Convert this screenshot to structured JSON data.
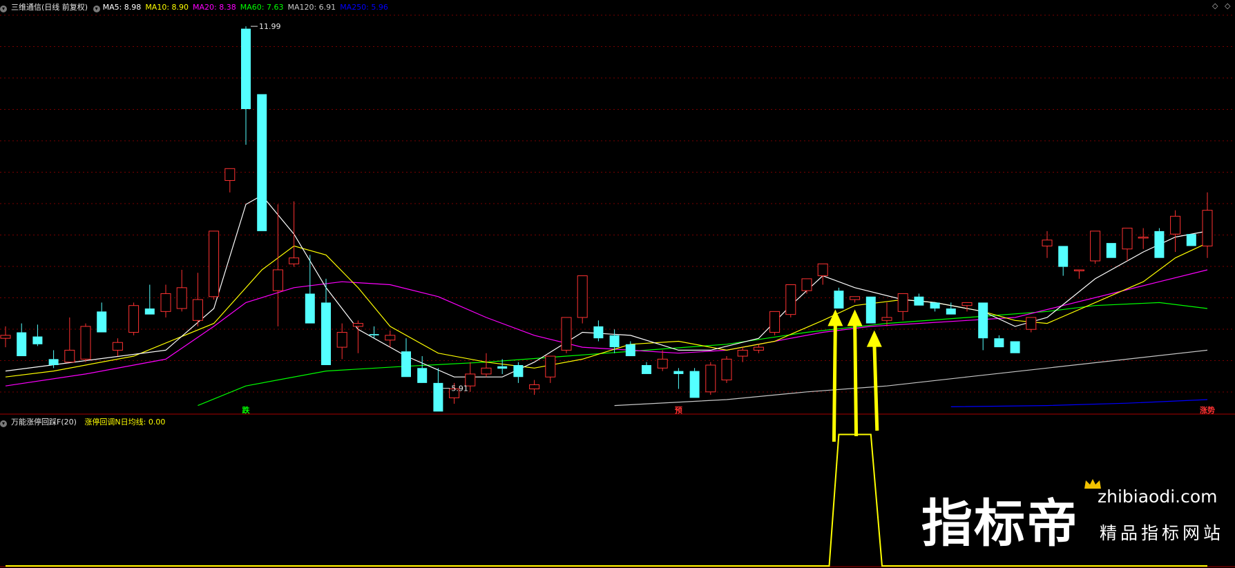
{
  "header_main": {
    "title": "三维通信(日线 前复权)",
    "indicators": [
      {
        "text": "MA5: 8.98",
        "color": "#ffffff"
      },
      {
        "text": "MA10: 8.90",
        "color": "#ffff00"
      },
      {
        "text": "MA20: 8.38",
        "color": "#ff00ff"
      },
      {
        "text": "MA60: 7.63",
        "color": "#00ff00"
      },
      {
        "text": "MA120: 6.91",
        "color": "#c8c8c8"
      },
      {
        "text": "MA250: 5.96",
        "color": "#0000ff"
      }
    ]
  },
  "header_sub": {
    "title": "万能涨停回踩F(20)",
    "indicator": "涨停回调N日均线: 0.00"
  },
  "window_buttons": {
    "restore": "◇",
    "maximize": "◇"
  },
  "watermark": {
    "cn": "指标帝",
    "url": "zhibiaodi.com",
    "sub": "精品指标网站"
  },
  "colors": {
    "up": "#ff3232",
    "down": "#54ffff",
    "ma5": "#ffffff",
    "ma10": "#ffff00",
    "ma20": "#ff00ff",
    "ma60": "#00ff00",
    "ma120": "#c8c8c8",
    "ma250": "#0000ff",
    "grid": "#7a0000",
    "signal": "#ffff00"
  },
  "chart_data": [
    {
      "type": "candlestick",
      "ylim": [
        5.5,
        12.2
      ],
      "annotations": [
        {
          "text": "11.99",
          "candle": 15,
          "price": 11.99
        },
        {
          "text": "5.91",
          "candle": 27,
          "price": 5.91
        }
      ],
      "markers": [
        {
          "text": "跌",
          "candle": 15,
          "color": "#00ff00"
        },
        {
          "text": "预",
          "candle": 42,
          "color": "#ff3232"
        },
        {
          "text": "涨势",
          "candle": 75,
          "color": "#ff3232"
        }
      ],
      "candles": [
        [
          6.75,
          6.95,
          6.6,
          6.8
        ],
        [
          6.85,
          7.0,
          6.45,
          6.45
        ],
        [
          6.78,
          6.98,
          6.62,
          6.65
        ],
        [
          6.4,
          6.55,
          6.25,
          6.3
        ],
        [
          6.35,
          7.1,
          6.35,
          6.55
        ],
        [
          6.4,
          7.0,
          6.35,
          6.95
        ],
        [
          7.2,
          7.35,
          6.9,
          6.85
        ],
        [
          6.55,
          6.75,
          6.45,
          6.68
        ],
        [
          6.85,
          7.35,
          6.8,
          7.3
        ],
        [
          7.25,
          7.65,
          7.2,
          7.15
        ],
        [
          7.2,
          7.65,
          7.1,
          7.5
        ],
        [
          7.25,
          7.9,
          7.2,
          7.6
        ],
        [
          7.05,
          7.85,
          6.95,
          7.4
        ],
        [
          7.45,
          7.95,
          7.4,
          8.55
        ],
        [
          9.4,
          9.6,
          9.2,
          9.6
        ],
        [
          11.95,
          11.99,
          10.0,
          10.6
        ],
        [
          10.85,
          10.85,
          8.55,
          8.55
        ],
        [
          7.55,
          9.0,
          6.95,
          7.9
        ],
        [
          8.0,
          9.05,
          7.95,
          8.1
        ],
        [
          7.5,
          8.15,
          7.15,
          7.0
        ],
        [
          7.35,
          7.75,
          6.85,
          6.3
        ],
        [
          6.6,
          7.0,
          6.4,
          6.85
        ],
        [
          6.95,
          7.05,
          6.5,
          7.0
        ],
        [
          6.82,
          6.95,
          6.75,
          6.8
        ],
        [
          6.72,
          6.88,
          6.6,
          6.8
        ],
        [
          6.53,
          6.75,
          6.3,
          6.1
        ],
        [
          6.25,
          6.45,
          6.0,
          6.0
        ],
        [
          6.0,
          6.25,
          5.65,
          5.52
        ],
        [
          5.75,
          6.0,
          5.65,
          5.9
        ],
        [
          5.95,
          6.35,
          5.85,
          6.15
        ],
        [
          6.15,
          6.5,
          6.1,
          6.25
        ],
        [
          6.28,
          6.4,
          6.15,
          6.24
        ],
        [
          6.3,
          6.35,
          6.0,
          6.1
        ],
        [
          5.9,
          6.05,
          5.8,
          5.97
        ],
        [
          6.1,
          6.25,
          6.0,
          6.45
        ],
        [
          6.55,
          7.0,
          6.5,
          7.1
        ],
        [
          7.1,
          7.3,
          7.0,
          7.8
        ],
        [
          6.95,
          7.05,
          6.7,
          6.75
        ],
        [
          6.8,
          6.9,
          6.5,
          6.6
        ],
        [
          6.65,
          6.7,
          6.45,
          6.45
        ],
        [
          6.3,
          6.35,
          6.15,
          6.15
        ],
        [
          6.25,
          6.55,
          6.2,
          6.4
        ],
        [
          6.2,
          6.25,
          5.9,
          6.15
        ],
        [
          6.2,
          6.25,
          5.85,
          5.75
        ],
        [
          5.85,
          6.35,
          5.8,
          6.3
        ],
        [
          6.05,
          6.45,
          6.0,
          6.4
        ],
        [
          6.45,
          6.6,
          6.35,
          6.55
        ],
        [
          6.55,
          6.65,
          6.5,
          6.6
        ],
        [
          6.85,
          7.1,
          6.8,
          7.2
        ],
        [
          7.15,
          7.35,
          7.1,
          7.65
        ],
        [
          7.55,
          7.75,
          7.5,
          7.75
        ],
        [
          7.8,
          8.0,
          7.65,
          8.0
        ],
        [
          7.55,
          7.6,
          7.35,
          7.25
        ],
        [
          7.4,
          7.45,
          7.35,
          7.45
        ],
        [
          7.45,
          7.3,
          7.0,
          7.0
        ],
        [
          7.05,
          7.35,
          6.95,
          7.1
        ],
        [
          7.2,
          7.5,
          7.05,
          7.5
        ],
        [
          7.45,
          7.5,
          7.35,
          7.3
        ],
        [
          7.35,
          7.3,
          7.2,
          7.25
        ],
        [
          7.25,
          7.35,
          7.2,
          7.15
        ],
        [
          7.3,
          7.35,
          7.2,
          7.35
        ],
        [
          7.35,
          7.0,
          6.55,
          6.75
        ],
        [
          6.75,
          6.8,
          6.65,
          6.6
        ],
        [
          6.7,
          6.65,
          6.5,
          6.5
        ],
        [
          6.9,
          7.1,
          6.85,
          7.1
        ],
        [
          8.3,
          8.55,
          8.1,
          8.4
        ],
        [
          8.3,
          8.25,
          7.8,
          7.95
        ],
        [
          7.9,
          7.85,
          7.75,
          7.9
        ],
        [
          8.05,
          8.55,
          8.0,
          8.55
        ],
        [
          8.35,
          8.35,
          8.1,
          8.1
        ],
        [
          8.25,
          8.6,
          8.05,
          8.6
        ],
        [
          8.45,
          8.6,
          8.25,
          8.45
        ],
        [
          8.55,
          8.6,
          8.1,
          8.1
        ],
        [
          8.5,
          8.9,
          8.2,
          8.8
        ],
        [
          8.5,
          8.5,
          8.3,
          8.3
        ],
        [
          8.3,
          9.2,
          8.1,
          8.9
        ]
      ],
      "ma5": [
        [
          0,
          6.2
        ],
        [
          10,
          6.55
        ],
        [
          13,
          7.25
        ],
        [
          15,
          9.0
        ],
        [
          16,
          9.15
        ],
        [
          18,
          8.5
        ],
        [
          20,
          7.6
        ],
        [
          22,
          6.9
        ],
        [
          25,
          6.45
        ],
        [
          28,
          6.1
        ],
        [
          31,
          6.1
        ],
        [
          33,
          6.35
        ],
        [
          36,
          6.85
        ],
        [
          39,
          6.8
        ],
        [
          42,
          6.55
        ],
        [
          44,
          6.55
        ],
        [
          47,
          6.75
        ],
        [
          49,
          7.3
        ],
        [
          51,
          7.8
        ],
        [
          53,
          7.6
        ],
        [
          56,
          7.4
        ],
        [
          58,
          7.35
        ],
        [
          61,
          7.2
        ],
        [
          63,
          6.95
        ],
        [
          65,
          7.1
        ],
        [
          68,
          7.75
        ],
        [
          71,
          8.2
        ],
        [
          73,
          8.45
        ],
        [
          75,
          8.55
        ]
      ],
      "ma10": [
        [
          0,
          6.1
        ],
        [
          3,
          6.2
        ],
        [
          8,
          6.45
        ],
        [
          13,
          7.0
        ],
        [
          16,
          7.9
        ],
        [
          18,
          8.3
        ],
        [
          20,
          8.15
        ],
        [
          22,
          7.6
        ],
        [
          24,
          6.95
        ],
        [
          27,
          6.5
        ],
        [
          30,
          6.35
        ],
        [
          33,
          6.25
        ],
        [
          36,
          6.4
        ],
        [
          39,
          6.65
        ],
        [
          42,
          6.7
        ],
        [
          45,
          6.55
        ],
        [
          48,
          6.7
        ],
        [
          51,
          7.05
        ],
        [
          53,
          7.3
        ],
        [
          56,
          7.4
        ],
        [
          58,
          7.35
        ],
        [
          61,
          7.2
        ],
        [
          63,
          7.05
        ],
        [
          65,
          7.0
        ],
        [
          68,
          7.35
        ],
        [
          71,
          7.7
        ],
        [
          73,
          8.1
        ],
        [
          75,
          8.35
        ]
      ],
      "ma20": [
        [
          0,
          5.95
        ],
        [
          5,
          6.15
        ],
        [
          10,
          6.4
        ],
        [
          13,
          6.95
        ],
        [
          15,
          7.35
        ],
        [
          18,
          7.6
        ],
        [
          21,
          7.7
        ],
        [
          24,
          7.65
        ],
        [
          27,
          7.45
        ],
        [
          30,
          7.1
        ],
        [
          33,
          6.8
        ],
        [
          36,
          6.6
        ],
        [
          39,
          6.55
        ],
        [
          42,
          6.5
        ],
        [
          45,
          6.55
        ],
        [
          48,
          6.7
        ],
        [
          51,
          6.85
        ],
        [
          54,
          6.95
        ],
        [
          57,
          7.0
        ],
        [
          60,
          7.05
        ],
        [
          63,
          7.1
        ],
        [
          66,
          7.3
        ],
        [
          69,
          7.5
        ],
        [
          72,
          7.7
        ],
        [
          75,
          7.9
        ]
      ],
      "ma60": [
        [
          12,
          5.62
        ],
        [
          15,
          5.95
        ],
        [
          20,
          6.2
        ],
        [
          25,
          6.28
        ],
        [
          30,
          6.35
        ],
        [
          35,
          6.45
        ],
        [
          40,
          6.55
        ],
        [
          45,
          6.65
        ],
        [
          50,
          6.85
        ],
        [
          55,
          7.0
        ],
        [
          60,
          7.1
        ],
        [
          65,
          7.2
        ],
        [
          68,
          7.3
        ],
        [
          72,
          7.35
        ],
        [
          75,
          7.25
        ]
      ],
      "ma120": [
        [
          38,
          5.62
        ],
        [
          45,
          5.72
        ],
        [
          50,
          5.85
        ],
        [
          55,
          5.95
        ],
        [
          60,
          6.1
        ],
        [
          65,
          6.25
        ],
        [
          70,
          6.4
        ],
        [
          75,
          6.55
        ]
      ],
      "ma250": [
        [
          59,
          5.6
        ],
        [
          65,
          5.62
        ],
        [
          70,
          5.66
        ],
        [
          75,
          5.72
        ]
      ]
    },
    {
      "type": "line",
      "ylim": [
        0,
        1.05
      ],
      "x": [
        0,
        51,
        52,
        53,
        54,
        55,
        75
      ],
      "values": [
        0,
        0,
        1,
        1,
        1,
        0,
        0
      ],
      "arrows_at": [
        52,
        53,
        54
      ]
    }
  ]
}
